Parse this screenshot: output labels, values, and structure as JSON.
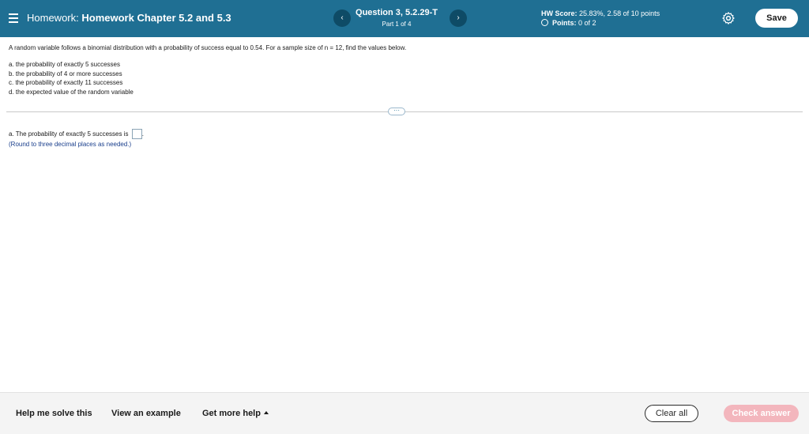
{
  "header": {
    "title_prefix": "Homework:",
    "title_name": "Homework Chapter 5.2 and 5.3",
    "question_title": "Question 3, 5.2.29-T",
    "question_part": "Part 1 of 4",
    "score_label": "HW Score:",
    "score_value": "25.83%, 2.58 of 10 points",
    "points_label": "Points:",
    "points_value": "0 of 2",
    "save_label": "Save",
    "prev_icon": "chevron-left-icon",
    "next_icon": "chevron-right-icon",
    "menu_icon": "hamburger-menu-icon",
    "settings_icon": "gear-icon",
    "accent_color": "#1f6f93"
  },
  "question": {
    "prompt": "A random variable follows a binomial distribution with a probability of success equal to 0.54. For a sample size of n = 12, find the values below.",
    "items": [
      "a. the probability of exactly 5 successes",
      "b. the probability of 4 or more successes",
      "c. the probability of exactly 11 successes",
      "d. the expected value of the random variable"
    ],
    "more_label": "···"
  },
  "answer": {
    "prefix": "a. The probability of exactly 5 successes is",
    "suffix": ".",
    "value": "",
    "hint": "(Round to three decimal places as needed.)"
  },
  "footer": {
    "help_solve": "Help me solve this",
    "view_example": "View an example",
    "get_more_help": "Get more help",
    "clear_all": "Clear all",
    "check_answer": "Check answer",
    "check_answer_color": "#f3b6bd"
  }
}
